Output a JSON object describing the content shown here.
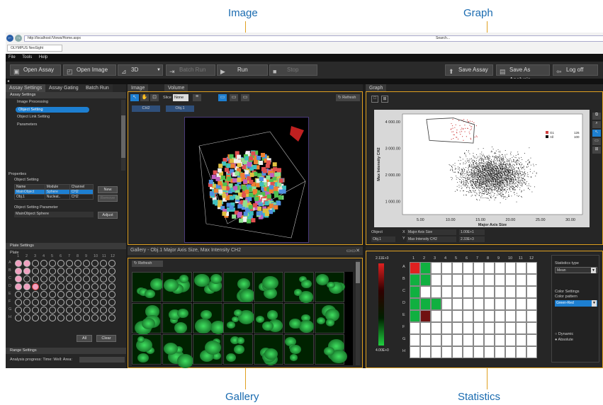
{
  "callouts": {
    "image": "Image",
    "graph": "Graph",
    "gallery": "Gallery",
    "statistics": "Statistics"
  },
  "browser": {
    "url": "http://localhost:/Views/Home.aspx",
    "search": "Search...",
    "tab": "OLYMPUS NeoSight",
    "nav_back": "←",
    "nav_fwd": "→"
  },
  "menu": [
    "File",
    "Tools",
    "Help"
  ],
  "toolbar": {
    "open_assay": "Open Assay",
    "open_image": "Open Image",
    "view3d": "3D",
    "batch_run": "Batch Run",
    "run": "Run",
    "stop": "Stop",
    "save_assay": "Save Assay",
    "save_as_analysis": "Save As Analysis",
    "log_off": "Log off"
  },
  "left": {
    "tabs": [
      "Assay Settings",
      "Assay Gating",
      "Batch Run"
    ],
    "assay_settings": "Assay Settings",
    "image_processing": "Image Processing",
    "object_setting": "Object Setting",
    "object_link_setting": "Object Link Setting",
    "parameters": "Parameters",
    "properties": "Properties",
    "object_setting_hdr": "Object Setting",
    "table_head": [
      "Name",
      "Module",
      "Channel"
    ],
    "rows": [
      [
        "MainObject",
        "Sphere",
        "CH2"
      ],
      [
        "Obj.1",
        "Nucleat..",
        "CH2"
      ]
    ],
    "new": "New",
    "remove": "Remove",
    "param_hdr": "Object Setting Parameter",
    "param_val": "MainObject Sphere",
    "adjust": "Adjust",
    "plate_settings": "Plate Settings",
    "plate": "Plate",
    "cols": [
      "1",
      "2",
      "3",
      "4",
      "5",
      "6",
      "7",
      "8",
      "9",
      "10",
      "11",
      "12"
    ],
    "rows_letters": [
      "A",
      "B",
      "C",
      "D",
      "E",
      "F",
      "G",
      "H"
    ],
    "all": "All",
    "clear": "Clear",
    "range_settings": "Range Settings",
    "progress": "Analysis progress:  Time:  Well:  Area:"
  },
  "image": {
    "tabs": [
      "Image",
      "Volume"
    ],
    "slice": "Slice",
    "slice_val": "None",
    "refresh": "Refresh",
    "channels": [
      "CH2",
      "Obj.1"
    ]
  },
  "graph": {
    "tab": "Graph",
    "ylabel": "Max Intensity CH2",
    "xlabel": "Major Axis Size",
    "legend": [
      [
        "G1",
        "126"
      ],
      [
        "All",
        "100"
      ]
    ],
    "object_label": "Object",
    "x_label": "X",
    "y_label": "Y",
    "x_param": "Major Axis Size",
    "y_param": "Max Intensity CH2",
    "x_val": "1.00E+1",
    "y_val": "2.33E+3",
    "obj_val": "Obj.1"
  },
  "chart_data": {
    "type": "scatter",
    "xlabel": "Major Axis Size",
    "ylabel": "Max Intensity CH2",
    "xticks": [
      "5.00",
      "10.00",
      "15.00",
      "20.00",
      "25.00",
      "30.00"
    ],
    "yticks": [
      "1 000.00",
      "2 000.00",
      "3 000.00",
      "4 000.00"
    ],
    "xlim": [
      2,
      32
    ],
    "ylim": [
      500,
      4300
    ],
    "series": [
      {
        "name": "G1",
        "color": "#d04040"
      },
      {
        "name": "All",
        "color": "#111111"
      }
    ]
  },
  "gallery": {
    "title": "Gallery - Obj.1 Major Axis Size, Max Intensity CH2",
    "refresh": "Refresh"
  },
  "stats": {
    "max": "2.11E+3",
    "min": "4.00E+0",
    "cols": [
      "1",
      "2",
      "3",
      "4",
      "5",
      "6",
      "7",
      "8",
      "9",
      "10",
      "11",
      "12"
    ],
    "rows": [
      "A",
      "B",
      "C",
      "D",
      "E",
      "F",
      "G",
      "H"
    ],
    "stat_type": "Statistics type",
    "stat_val": "Mean",
    "color_settings": "Color Settings",
    "color_pattern": "Color pattern",
    "color_val": "Green-Red",
    "dynamic": "Dynamic",
    "absolute": "Absolute"
  }
}
